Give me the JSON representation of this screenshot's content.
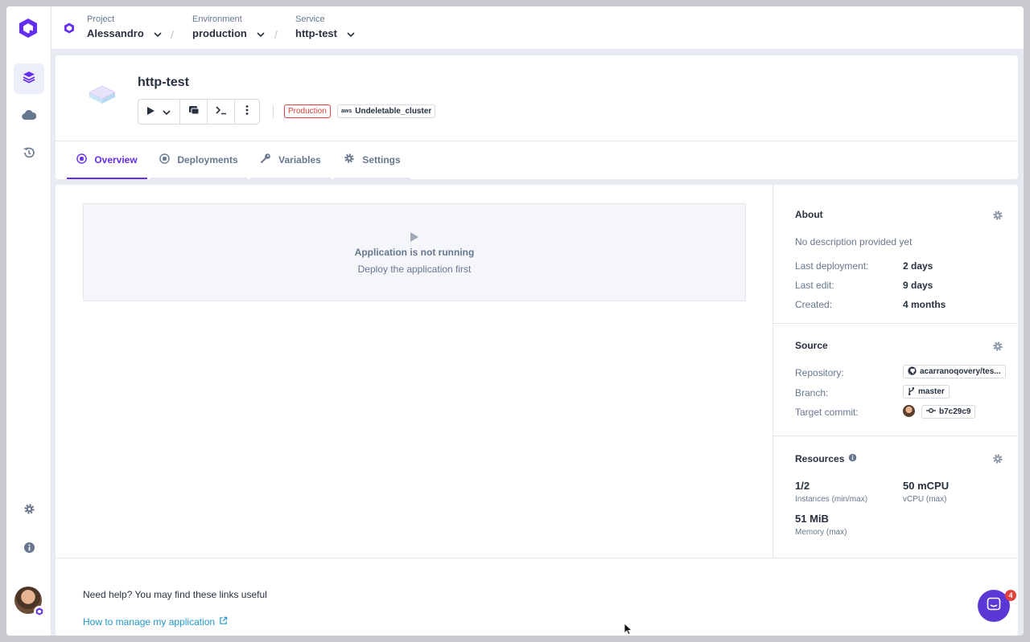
{
  "breadcrumb": {
    "project": {
      "label": "Project",
      "value": "Alessandro"
    },
    "environment": {
      "label": "Environment",
      "value": "production"
    },
    "service": {
      "label": "Service",
      "value": "http-test"
    },
    "separator": "/"
  },
  "service": {
    "title": "http-test",
    "env_badge": "Production",
    "cluster_provider": "aws",
    "cluster_name": "Undeletable_cluster"
  },
  "tabs": [
    {
      "label": "Overview",
      "icon": "overview-icon",
      "active": true
    },
    {
      "label": "Deployments",
      "icon": "deployments-icon",
      "active": false
    },
    {
      "label": "Variables",
      "icon": "key-icon",
      "active": false
    },
    {
      "label": "Settings",
      "icon": "gear-icon",
      "active": false
    }
  ],
  "status_panel": {
    "title": "Application is not running",
    "subtitle": "Deploy the application first"
  },
  "about": {
    "title": "About",
    "description": "No description provided yet",
    "rows": [
      {
        "key": "Last deployment:",
        "value": "2 days"
      },
      {
        "key": "Last edit:",
        "value": "9 days"
      },
      {
        "key": "Created:",
        "value": "4 months"
      }
    ]
  },
  "source": {
    "title": "Source",
    "repository_label": "Repository:",
    "repository": "acarranoqovery/tes...",
    "branch_label": "Branch:",
    "branch": "master",
    "commit_label": "Target commit:",
    "commit": "b7c29c9"
  },
  "resources": {
    "title": "Resources",
    "items": [
      {
        "value": "1/2",
        "label": "Instances (min/max)"
      },
      {
        "value": "50 mCPU",
        "label": "vCPU (max)"
      },
      {
        "value": "51 MiB",
        "label": "Memory (max)"
      }
    ]
  },
  "help": {
    "text": "Need help? You may find these links useful",
    "link": "How to manage my application"
  },
  "chat": {
    "unread": "4"
  },
  "colors": {
    "accent": "#642df0",
    "danger": "#e0413c",
    "link": "#2196c9",
    "text": "#273140",
    "muted": "#67778e"
  }
}
